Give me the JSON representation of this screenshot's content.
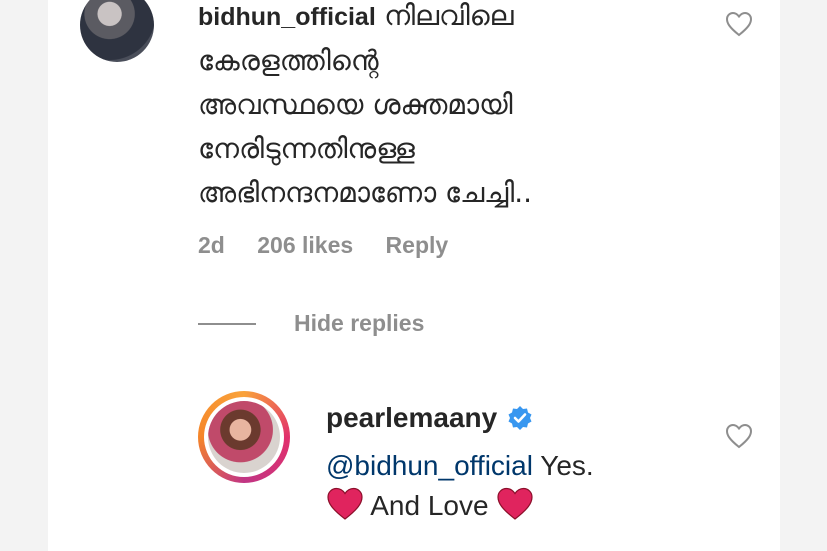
{
  "comment": {
    "username": "bidhun_official",
    "text_lines": [
      "നിലവിലെ",
      "കേരളത്തിന്റെ",
      "അവസ്ഥയെ ശക്തമായി",
      "നേരിടുന്നതിനുള്ള",
      "അഭിനന്ദനമാണോ ചേച്ചി.."
    ],
    "time": "2d",
    "likes": "206 likes",
    "reply_label": "Reply",
    "like_icon": "heart-outline-icon"
  },
  "hide_replies_label": "Hide replies",
  "reply": {
    "username": "pearlemaany",
    "verified_icon": "verified-badge-icon",
    "mention": "@bidhun_official",
    "text_after_mention": "Yes.",
    "second_line": "And Love",
    "emoji": "red-heart",
    "like_icon": "heart-outline-icon"
  },
  "colors": {
    "text": "#262626",
    "secondary": "#8e8e8e",
    "mention": "#00376b",
    "verified": "#3897f0",
    "heart": "#e0245e"
  }
}
